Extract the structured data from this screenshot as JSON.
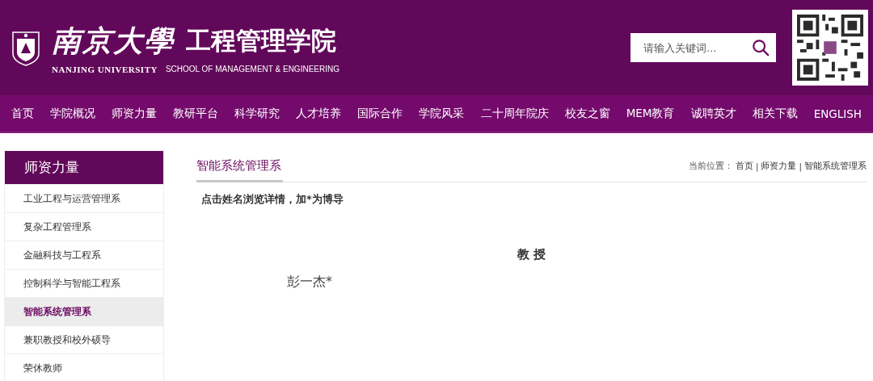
{
  "header": {
    "logo_cn": "南京大學",
    "school_cn": "工程管理学院",
    "logo_en": "NANJING UNIVERSITY",
    "school_en": "SCHOOL OF MANAGEMENT & ENGINEERING",
    "search": {
      "placeholder": "请输入关键词..."
    }
  },
  "nav": [
    {
      "label": "首页"
    },
    {
      "label": "学院概况"
    },
    {
      "label": "师资力量"
    },
    {
      "label": "教研平台"
    },
    {
      "label": "科学研究"
    },
    {
      "label": "人才培养"
    },
    {
      "label": "国际合作"
    },
    {
      "label": "学院风采"
    },
    {
      "label": "二十周年院庆"
    },
    {
      "label": "校友之窗"
    },
    {
      "label": "MEM教育"
    },
    {
      "label": "诚聘英才"
    },
    {
      "label": "相关下载"
    },
    {
      "label": "ENGLISH"
    }
  ],
  "sidebar": {
    "title": "师资力量",
    "items": [
      {
        "label": "工业工程与运营管理系",
        "selected": false
      },
      {
        "label": "复杂工程管理系",
        "selected": false
      },
      {
        "label": "金融科技与工程系",
        "selected": false
      },
      {
        "label": "控制科学与智能工程系",
        "selected": false
      },
      {
        "label": "智能系统管理系",
        "selected": true
      },
      {
        "label": "兼职教授和校外硕导",
        "selected": false
      },
      {
        "label": "荣休教师",
        "selected": false
      }
    ]
  },
  "content": {
    "title": "智能系统管理系",
    "breadcrumb": {
      "label": "当前位置：",
      "separator": "|",
      "items": [
        "首页",
        "师资力量",
        "智能系统管理系"
      ]
    },
    "note": "点击姓名浏览详情，加*为博导",
    "groups": [
      {
        "heading": "教 授",
        "names": [
          "彭一杰*"
        ]
      }
    ]
  }
}
